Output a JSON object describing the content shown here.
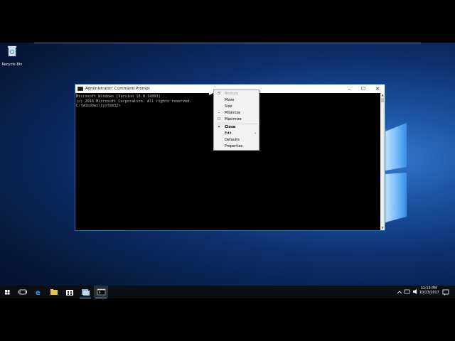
{
  "desktop": {
    "recycle_bin_label": "Recycle Bin"
  },
  "console_window": {
    "title": "Administrator: Command Prompt",
    "buttons": {
      "minimize": "–",
      "maximize": "☐",
      "close": "✕"
    },
    "lines": [
      "Microsoft Windows [Version 10.0.14393]",
      "(c) 2016 Microsoft Corporation. All rights reserved.",
      "",
      "C:\\Windows\\system32>"
    ]
  },
  "context_menu": {
    "items": [
      {
        "label": "Restore",
        "glyph": "🗗",
        "disabled": true
      },
      {
        "label": "Move",
        "glyph": "",
        "disabled": false
      },
      {
        "label": "Size",
        "glyph": "",
        "disabled": false
      },
      {
        "label": "Minimize",
        "glyph": "–",
        "disabled": false
      },
      {
        "label": "Maximize",
        "glyph": "☐",
        "disabled": false
      },
      {
        "label": "Close",
        "glyph": "✕",
        "disabled": false,
        "bold": true
      },
      {
        "label": "Edit",
        "glyph": "",
        "disabled": false,
        "submenu": "›"
      },
      {
        "label": "Defaults",
        "glyph": "",
        "disabled": false
      },
      {
        "label": "Properties",
        "glyph": "",
        "disabled": false
      }
    ]
  },
  "taskbar": {
    "clock_time": "12:13 PM",
    "clock_date": "10/23/2017"
  },
  "colors": {
    "accent": "#1e6bb8",
    "taskbar": "#0b0f14",
    "active_underline": "#76b9ed"
  }
}
